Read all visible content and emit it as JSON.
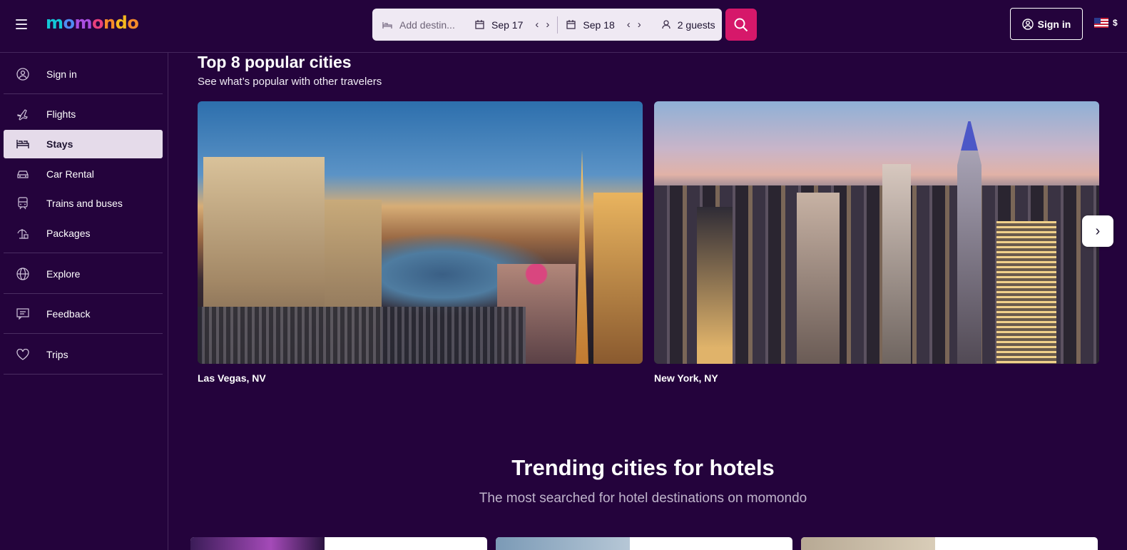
{
  "header": {
    "logo_letters": [
      "m",
      "o",
      "m",
      "o",
      "n",
      "d",
      "o"
    ],
    "search": {
      "destination_placeholder": "Add destin...",
      "checkin": "Sep 17",
      "checkout": "Sep 18",
      "guests": "2 guests"
    },
    "signin_label": "Sign in",
    "currency": "$"
  },
  "sidebar": {
    "items": [
      {
        "label": "Sign in",
        "icon": "user-circle-icon"
      },
      {
        "label": "Flights",
        "icon": "plane-icon"
      },
      {
        "label": "Stays",
        "icon": "bed-icon",
        "active": true
      },
      {
        "label": "Car Rental",
        "icon": "car-icon"
      },
      {
        "label": "Trains and buses",
        "icon": "train-icon"
      },
      {
        "label": "Packages",
        "icon": "packages-icon"
      },
      {
        "label": "Explore",
        "icon": "globe-icon"
      },
      {
        "label": "Feedback",
        "icon": "feedback-icon"
      },
      {
        "label": "Trips",
        "icon": "heart-icon"
      }
    ]
  },
  "popular": {
    "title": "Top 8 popular cities",
    "subtitle": "See what’s popular with other travelers",
    "cities": [
      {
        "name": "Las Vegas, NV"
      },
      {
        "name": "New York, NY"
      }
    ]
  },
  "trending": {
    "title": "Trending cities for hotels",
    "subtitle": "The most searched for hotel destinations on momondo"
  },
  "colors": {
    "background": "#24033c",
    "accent": "#d6186a",
    "active_nav": "#e5dbea"
  }
}
